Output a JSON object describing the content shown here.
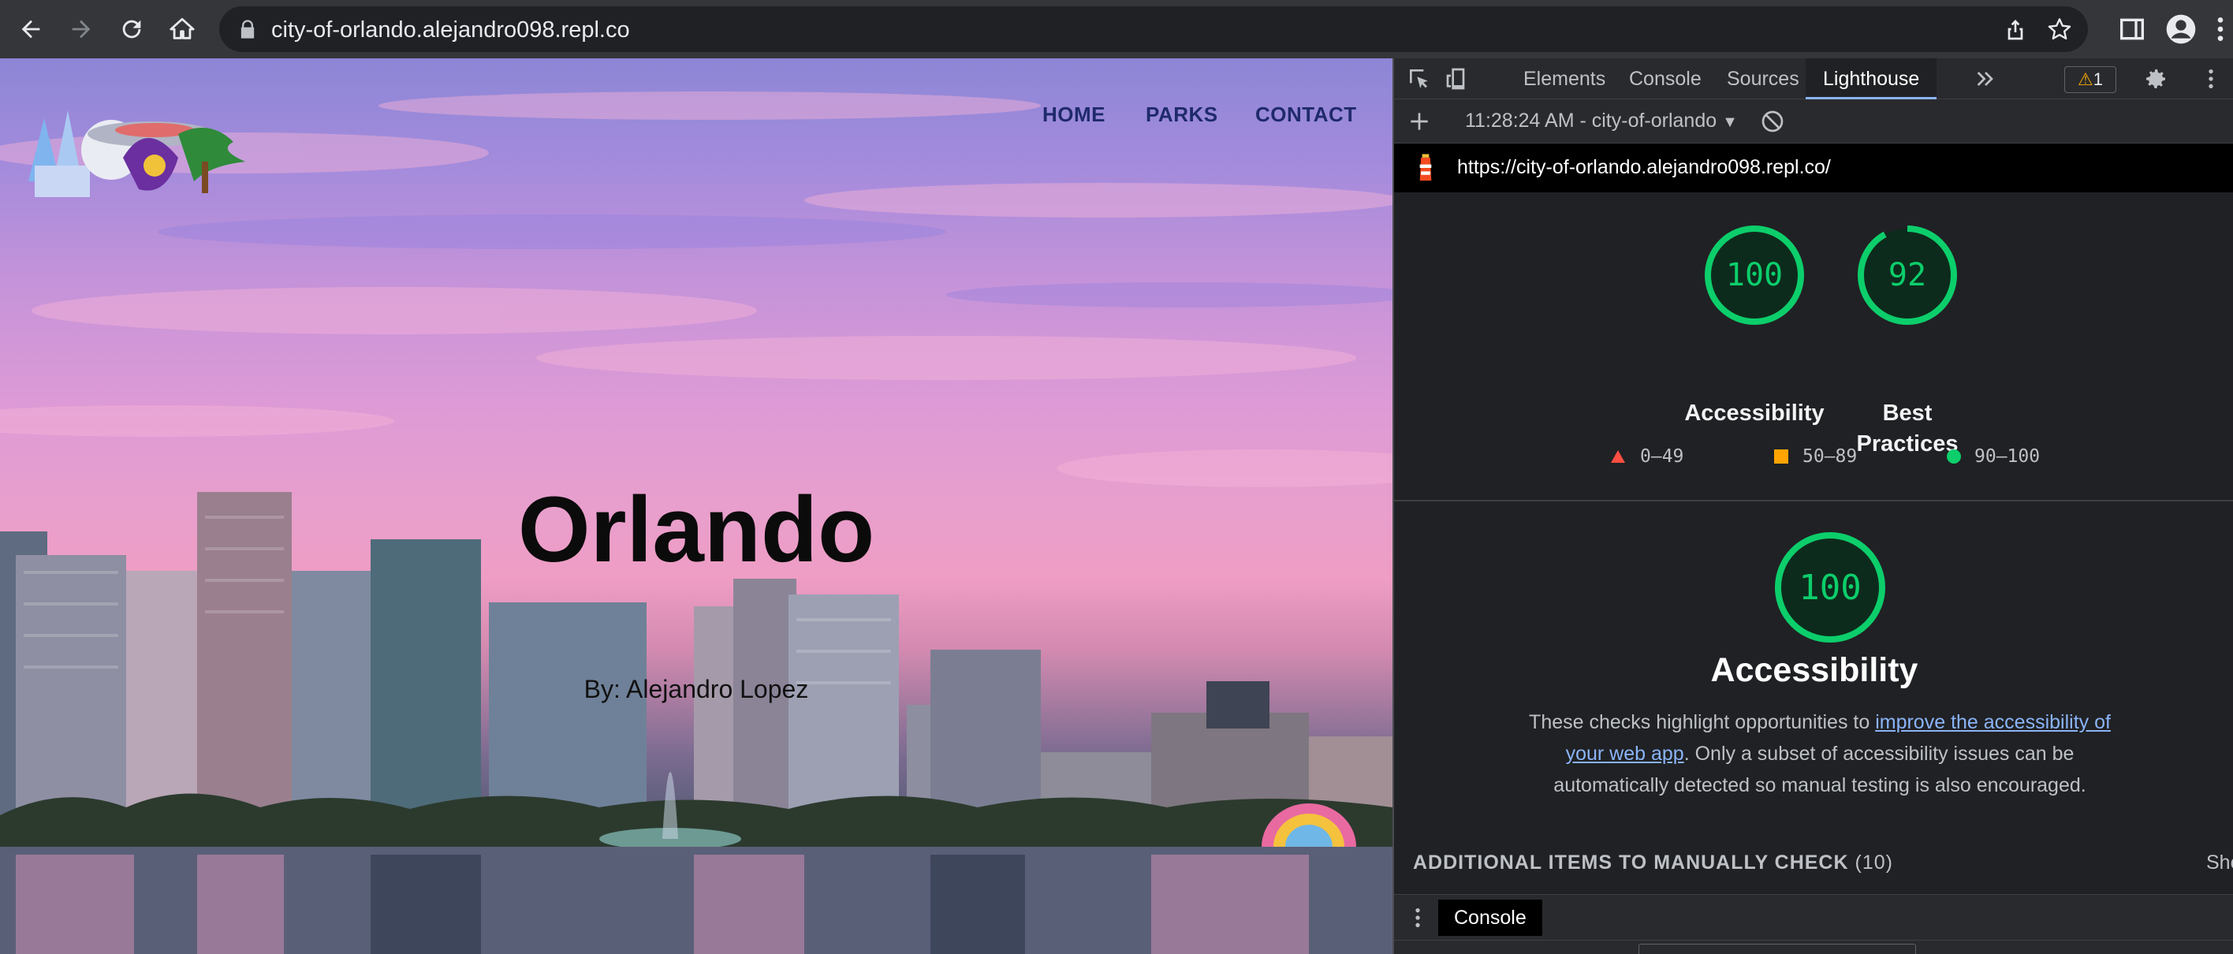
{
  "browser": {
    "url": "city-of-orlando.alejandro098.repl.co",
    "icons": [
      "back-arrow-icon",
      "forward-arrow-icon",
      "reload-icon",
      "home-icon",
      "lock-icon",
      "share-icon",
      "bookmark-star-icon",
      "side-panel-icon",
      "profile-icon",
      "kebab-menu-icon"
    ]
  },
  "site": {
    "nav": [
      "HOME",
      "PARKS",
      "CONTACT"
    ],
    "title": "Orlando",
    "byline": "By: Alejandro Lopez"
  },
  "devtools": {
    "tabs": [
      "Elements",
      "Console",
      "Sources",
      "Lighthouse"
    ],
    "active_tab": "Lighthouse",
    "warning_count": "1",
    "report_selector": "11:28:24 AM - city-of-orlando",
    "report_url": "https://city-of-orlando.alejandro098.repl.co/",
    "scores": [
      {
        "value": 100,
        "label": "Accessibility",
        "color": "#0cce6b"
      },
      {
        "value": 92,
        "label_line1": "Best",
        "label_line2": "Practices",
        "color": "#0cce6b"
      }
    ],
    "legend": [
      "0–49",
      "50–89",
      "90–100"
    ],
    "legend_colors": [
      "#ff4e42",
      "#ffa400",
      "#0cce6b"
    ],
    "category": {
      "score": 100,
      "title": "Accessibility",
      "desc_before": "These checks highlight opportunities to ",
      "desc_link": "improve the accessibility of your web app",
      "desc_after": ". Only a subset of accessibility issues can be automatically detected so manual testing is also encouraged."
    },
    "manual_check": "ADDITIONAL ITEMS TO MANUALLY CHECK",
    "manual_check_count": "(10)",
    "show_link": "Sho",
    "drawer_tab": "Console"
  }
}
